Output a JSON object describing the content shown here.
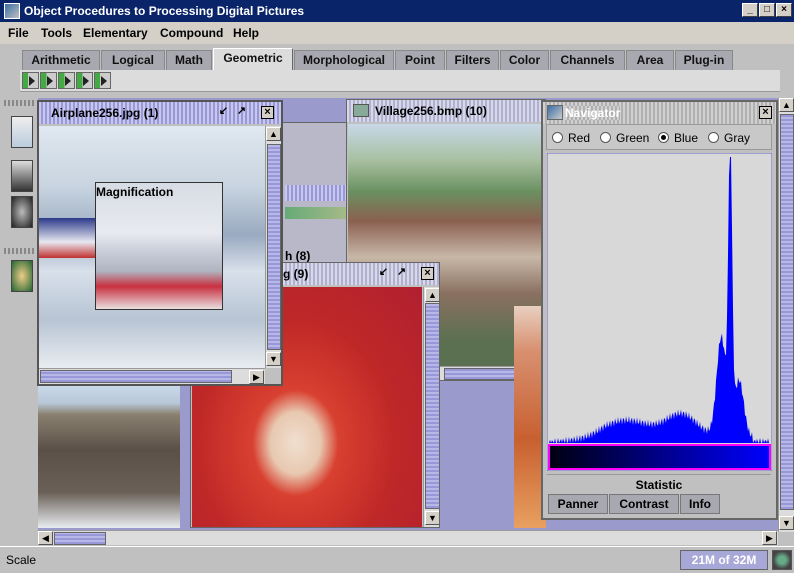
{
  "window": {
    "title": "Object Procedures to Processing Digital Pictures",
    "minimize": "_",
    "maximize": "□",
    "close": "×"
  },
  "menu": [
    "File",
    "Tools",
    "Elementary",
    "Compound",
    "Help"
  ],
  "tabs": [
    "Arithmetic",
    "Logical",
    "Math",
    "Geometric",
    "Morphological",
    "Point",
    "Filters",
    "Color",
    "Channels",
    "Area",
    "Plug-in"
  ],
  "active_tab": "Geometric",
  "frames": {
    "airplane": {
      "title": "Airplane256.jpg (1)",
      "overlay": "Magnification"
    },
    "village": {
      "title": "Village256.bmp (10)"
    },
    "splash": {
      "title": "g (9)"
    },
    "hidden": {
      "title": "h (8)"
    }
  },
  "navigator": {
    "title": "Navigator",
    "channels": [
      "Red",
      "Green",
      "Blue",
      "Gray"
    ],
    "selected_channel": "Blue",
    "statistic_label": "Statistic",
    "tabs": [
      "Panner",
      "Contrast",
      "Info"
    ],
    "histogram_color": "#0000ff"
  },
  "status": {
    "text": "Scale",
    "memory": "21M of 32M"
  }
}
